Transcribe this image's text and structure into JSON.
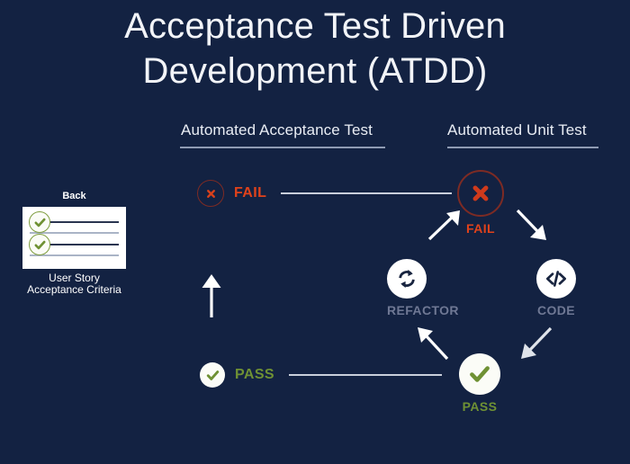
{
  "page": {
    "background_color": "#132242",
    "title_lines": [
      "Acceptance Test Driven",
      "Development (ATDD)"
    ]
  },
  "headers": {
    "acceptance": "Automated Acceptance Test",
    "unit": "Automated Unit Test"
  },
  "user_story": {
    "back_label": "Back",
    "caption_line1": "User Story",
    "caption_line2": "Acceptance Criteria",
    "checkmark_count": 2,
    "line_count": 4,
    "card_color": "#ffffff",
    "check_color": "#6f9134"
  },
  "nodes": {
    "acceptance_fail": {
      "label": "FAIL",
      "icon": "circle-x-icon",
      "color": "#e0421b"
    },
    "unit_fail": {
      "label": "FAIL",
      "icon": "circle-x-icon",
      "color": "#e0421b"
    },
    "refactor": {
      "label": "REFACTOR",
      "icon": "refresh-cycle-icon",
      "color": "#6f7894"
    },
    "code": {
      "label": "CODE",
      "icon": "code-brackets-icon",
      "color": "#6f7894"
    },
    "unit_pass": {
      "label": "PASS",
      "icon": "circle-check-icon",
      "color": "#6f9134"
    },
    "acceptance_pass": {
      "label": "PASS",
      "icon": "circle-check-icon",
      "color": "#6f9134"
    }
  },
  "connectors": {
    "fail_line": "horizontal-rule",
    "pass_line": "horizontal-rule",
    "arrow_up_left_column": "arrow-up",
    "arrow_up_right_to_fail": "arrow-up-right",
    "arrow_fail_to_code": "arrow-down-right",
    "arrow_code_to_pass": "arrow-down-left",
    "arrow_pass_to_refactor": "arrow-up-left"
  }
}
